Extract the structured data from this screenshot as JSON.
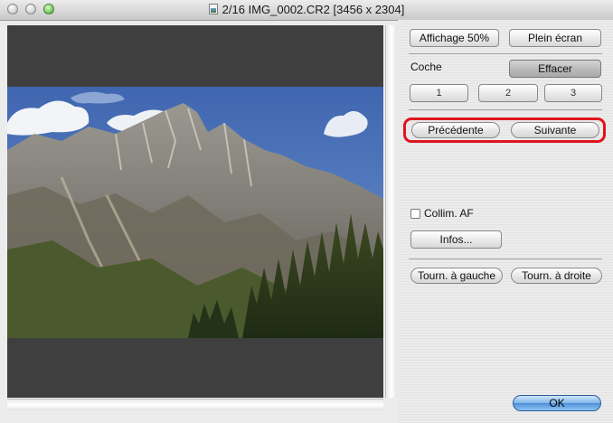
{
  "window": {
    "title": "2/16 IMG_0002.CR2 [3456 x 2304]",
    "icon": "document-icon"
  },
  "buttons": {
    "view50": "Affichage 50%",
    "fullscreen": "Plein écran",
    "clear": "Effacer",
    "check1": "1",
    "check2": "2",
    "check3": "3",
    "previous": "Précédente",
    "next": "Suivante",
    "info": "Infos...",
    "rotate_left": "Tourn. à gauche",
    "rotate_right": "Tourn. à droite",
    "ok": "OK"
  },
  "labels": {
    "check": "Coche",
    "af_points": "Collim. AF"
  },
  "state": {
    "af_points_checked": false
  },
  "colors": {
    "highlight": "#e0141e",
    "ok_button": "#6aa6e6"
  }
}
